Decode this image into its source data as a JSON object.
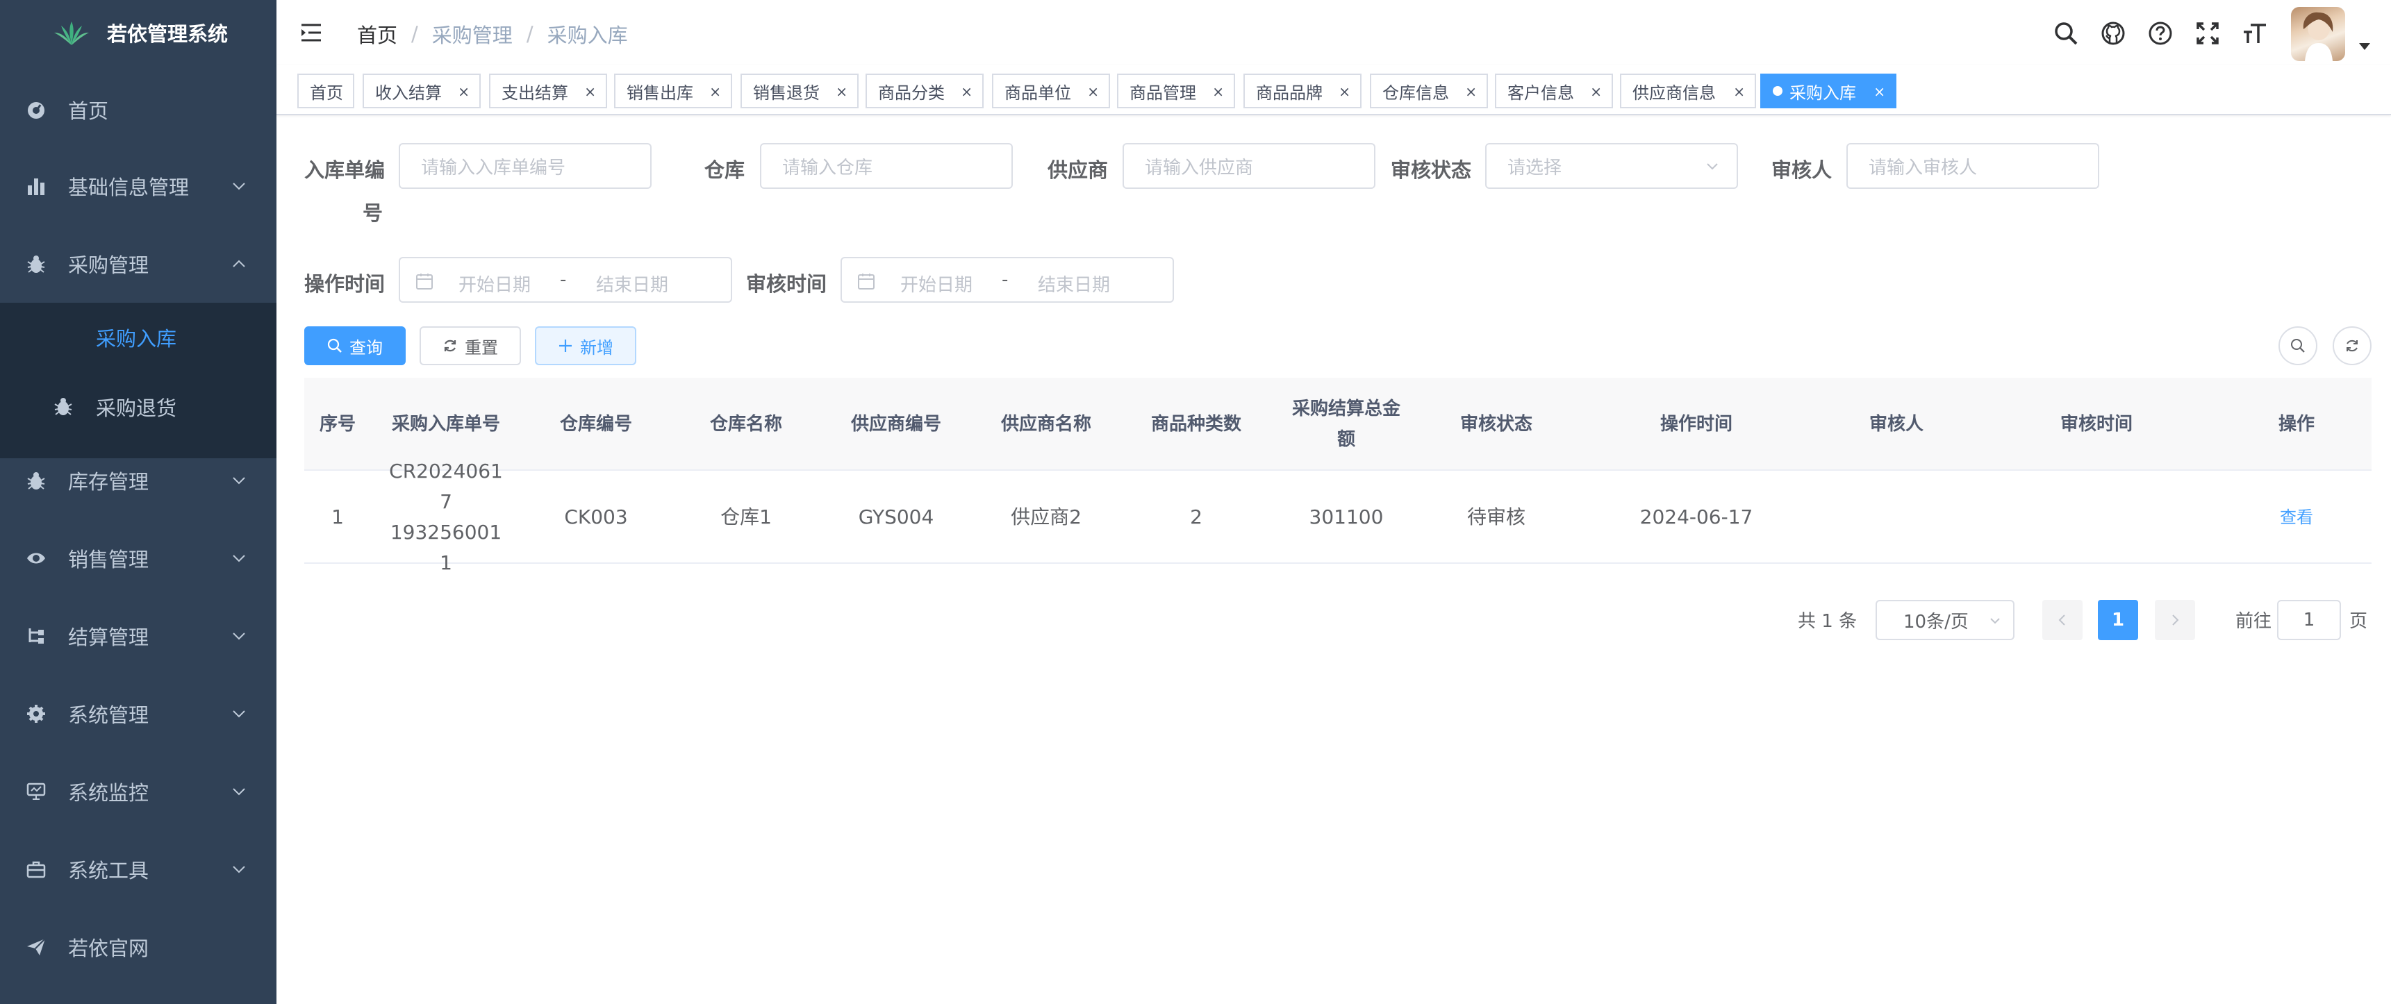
{
  "app": {
    "title": "若依管理系统"
  },
  "sidebar": {
    "items": [
      {
        "label": "首页",
        "icon": "dashboard-icon"
      },
      {
        "label": "基础信息管理",
        "icon": "bar-chart-icon"
      },
      {
        "label": "采购管理",
        "icon": "bug-icon"
      },
      {
        "label": "库存管理",
        "icon": "bug-icon"
      },
      {
        "label": "销售管理",
        "icon": "eye-icon"
      },
      {
        "label": "结算管理",
        "icon": "tree-icon"
      },
      {
        "label": "系统管理",
        "icon": "gear-icon"
      },
      {
        "label": "系统监控",
        "icon": "monitor-icon"
      },
      {
        "label": "系统工具",
        "icon": "toolbox-icon"
      },
      {
        "label": "若依官网",
        "icon": "send-icon"
      }
    ],
    "sub_items": [
      {
        "label": "采购入库"
      },
      {
        "label": "采购退货"
      }
    ]
  },
  "breadcrumb": [
    "首页",
    "采购管理",
    "采购入库"
  ],
  "tags": [
    "首页",
    "收入结算",
    "支出结算",
    "销售出库",
    "销售退货",
    "商品分类",
    "商品单位",
    "商品管理",
    "商品品牌",
    "仓库信息",
    "客户信息",
    "供应商信息",
    "采购入库"
  ],
  "search": {
    "order_no_label_1": "入库单编",
    "order_no_label_2": "号",
    "order_no_placeholder": "请输入入库单编号",
    "warehouse_label": "仓库",
    "warehouse_placeholder": "请输入仓库",
    "supplier_label": "供应商",
    "supplier_placeholder": "请输入供应商",
    "status_label": "审核状态",
    "status_placeholder": "请选择",
    "auditor_label": "审核人",
    "auditor_placeholder": "请输入审核人",
    "op_time_label": "操作时间",
    "audit_time_label": "审核时间",
    "start_date": "开始日期",
    "end_date": "结束日期",
    "range_sep": "-"
  },
  "toolbar": {
    "query": "查询",
    "reset": "重置",
    "add": "新增"
  },
  "table": {
    "headers": [
      "序号",
      "采购入库单号",
      "仓库编号",
      "仓库名称",
      "供应商编号",
      "供应商名称",
      "商品种类数",
      "采购结算总金额",
      "审核状态",
      "操作时间",
      "审核人",
      "审核时间",
      "操作"
    ],
    "rows": [
      {
        "index": "1",
        "order_no": "CR20240617\n1932560011",
        "warehouse_code": "CK003",
        "warehouse_name": "仓库1",
        "supplier_code": "GYS004",
        "supplier_name": "供应商2",
        "kinds": "2",
        "total": "301100",
        "status": "待审核",
        "op_time": "2024-06-17",
        "auditor": "",
        "audit_time": "",
        "action": "查看"
      }
    ]
  },
  "pagination": {
    "total": "共 1 条",
    "page_size": "10条/页",
    "current": "1",
    "goto_prefix": "前往",
    "goto_value": "1",
    "goto_suffix": "页"
  },
  "colors": {
    "sidebar_bg": "#304156",
    "submenu_bg": "#1f2d3d",
    "primary": "#409eff"
  }
}
